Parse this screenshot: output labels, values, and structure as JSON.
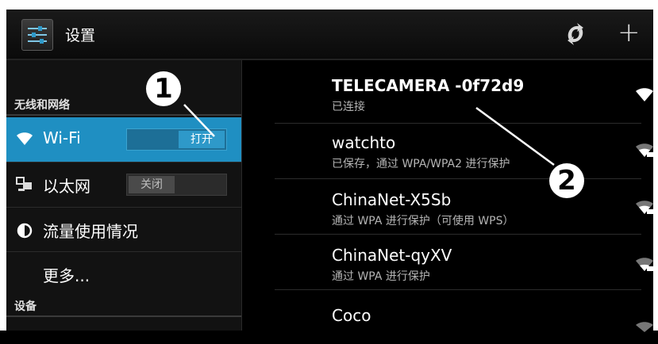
{
  "actionbar": {
    "title": "设置",
    "app_icon": "settings-sliders-icon",
    "sync_icon": "sync-icon",
    "add_icon": "plus-icon",
    "add_glyph": "+"
  },
  "left_pane": {
    "section_wireless": "无线和网络",
    "wifi": {
      "label": "Wi-Fi",
      "icon": "wifi-icon",
      "toggle_label": "打开",
      "state": "on"
    },
    "ethernet": {
      "label": "以太网",
      "icon": "ethernet-icon",
      "toggle_label": "关闭",
      "state": "off"
    },
    "data_usage": {
      "label": "流量使用情况",
      "icon": "data-usage-icon"
    },
    "more": {
      "label": "更多..."
    },
    "section_device": "设备"
  },
  "networks": [
    {
      "name": "TELECAMERA -0f72d9",
      "status": "已连接",
      "secured": false
    },
    {
      "name": "watchto",
      "status": "已保存，通过 WPA/WPA2 进行保护",
      "secured": true
    },
    {
      "name": "ChinaNet-X5Sb",
      "status": "通过 WPA 进行保护（可使用 WPS）",
      "secured": true
    },
    {
      "name": "ChinaNet-qyXV",
      "status": "通过 WPA 进行保护",
      "secured": true
    },
    {
      "name": "Coco",
      "status": "",
      "secured": true
    }
  ],
  "annotations": {
    "callout_1": "1",
    "callout_2": "2"
  },
  "colors": {
    "accent": "#1f8fc2",
    "background": "#000000",
    "pane": "#121212"
  }
}
